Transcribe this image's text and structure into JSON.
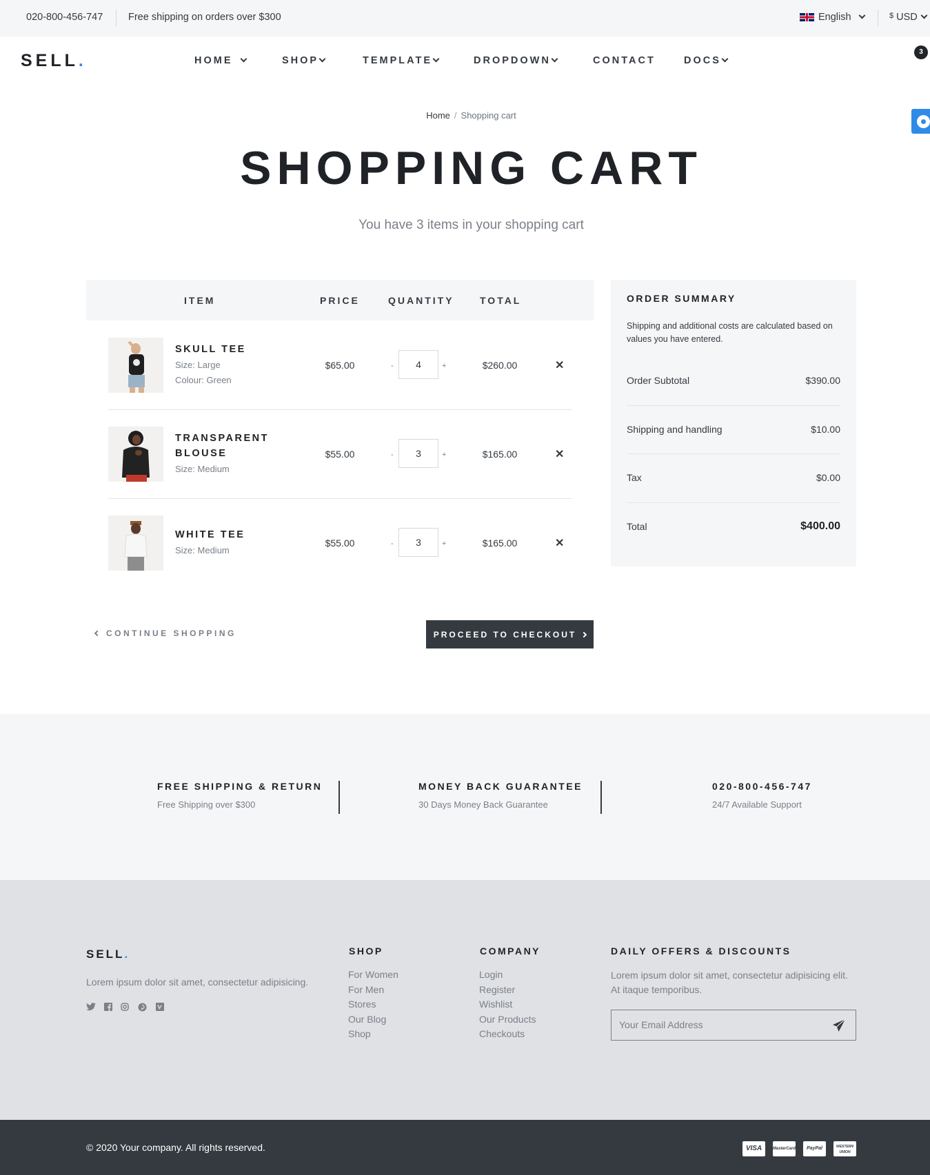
{
  "topbar": {
    "phone": "020-800-456-747",
    "shipping": "Free shipping on orders over $300",
    "language": "English",
    "currency_symbol": "$",
    "currency": "USD"
  },
  "header": {
    "logo": "SELL",
    "logo_dot": ".",
    "nav": [
      "HOME",
      "SHOP",
      "TEMPLATE",
      "DROPDOWN",
      "CONTACT",
      "DOCS"
    ],
    "cart_count": "3"
  },
  "breadcrumb": {
    "home": "Home",
    "separator": "/",
    "current": "Shopping cart"
  },
  "page": {
    "title": "SHOPPING CART",
    "subtitle": "You have 3 items in your shopping cart"
  },
  "cart": {
    "columns": [
      "ITEM",
      "PRICE",
      "QUANTITY",
      "TOTAL"
    ],
    "minus": "-",
    "plus": "+",
    "remove": "✕",
    "items": [
      {
        "name": "SKULL TEE",
        "attrs": [
          "Size: Large",
          "Colour: Green"
        ],
        "price": "$65.00",
        "qty": "4",
        "total": "$260.00"
      },
      {
        "name_line1": "TRANSPARENT",
        "name_line2": "BLOUSE",
        "attrs": [
          "Size: Medium"
        ],
        "price": "$55.00",
        "qty": "3",
        "total": "$165.00"
      },
      {
        "name": "WHITE TEE",
        "attrs": [
          "Size: Medium"
        ],
        "price": "$55.00",
        "qty": "3",
        "total": "$165.00"
      }
    ],
    "continue": "CONTINUE SHOPPING",
    "checkout": "PROCEED TO CHECKOUT"
  },
  "summary": {
    "title": "ORDER SUMMARY",
    "note": "Shipping and additional costs are calculated based on values you have entered.",
    "rows": [
      {
        "label": "Order Subtotal",
        "value": "$390.00"
      },
      {
        "label": "Shipping and handling",
        "value": "$10.00"
      },
      {
        "label": "Tax",
        "value": "$0.00"
      },
      {
        "label": "Total",
        "value": "$400.00"
      }
    ]
  },
  "features": [
    {
      "title": "FREE SHIPPING & RETURN",
      "sub": "Free Shipping over $300"
    },
    {
      "title": "MONEY BACK GUARANTEE",
      "sub": "30 Days Money Back Guarantee"
    },
    {
      "title": "020-800-456-747",
      "sub": "24/7 Available Support"
    }
  ],
  "footer": {
    "logo": "SELL",
    "about": "Lorem ipsum dolor sit amet, consectetur adipisicing.",
    "shop_title": "SHOP",
    "shop_links": [
      "For Women",
      "For Men",
      "Stores",
      "Our Blog",
      "Shop"
    ],
    "company_title": "COMPANY",
    "company_links": [
      "Login",
      "Register",
      "Wishlist",
      "Our Products",
      "Checkouts"
    ],
    "offers_title": "DAILY OFFERS & DISCOUNTS",
    "offers_text_line1": "Lorem ipsum dolor sit amet, consectetur adipisicing elit.",
    "offers_text_line2": "At itaque temporibus.",
    "email_placeholder": "Your Email Address",
    "copyright": "© 2020 Your company. All rights reserved.",
    "payments": [
      "VISA",
      "MasterCard",
      "PayPal",
      "WESTERN UNION"
    ]
  },
  "colors": {
    "accent": "#2f8be6",
    "dark": "#343a40",
    "muted": "#7a8088",
    "panel": "#f5f6f8",
    "footer": "#dfe1e5"
  },
  "icons": [
    "flag-uk-icon",
    "chevron-down-icon",
    "cart-icon",
    "gear-icon",
    "close-icon",
    "chevron-left-icon",
    "chevron-right-icon",
    "twitter-icon",
    "facebook-icon",
    "instagram-icon",
    "pinterest-icon",
    "vimeo-icon",
    "send-icon"
  ]
}
